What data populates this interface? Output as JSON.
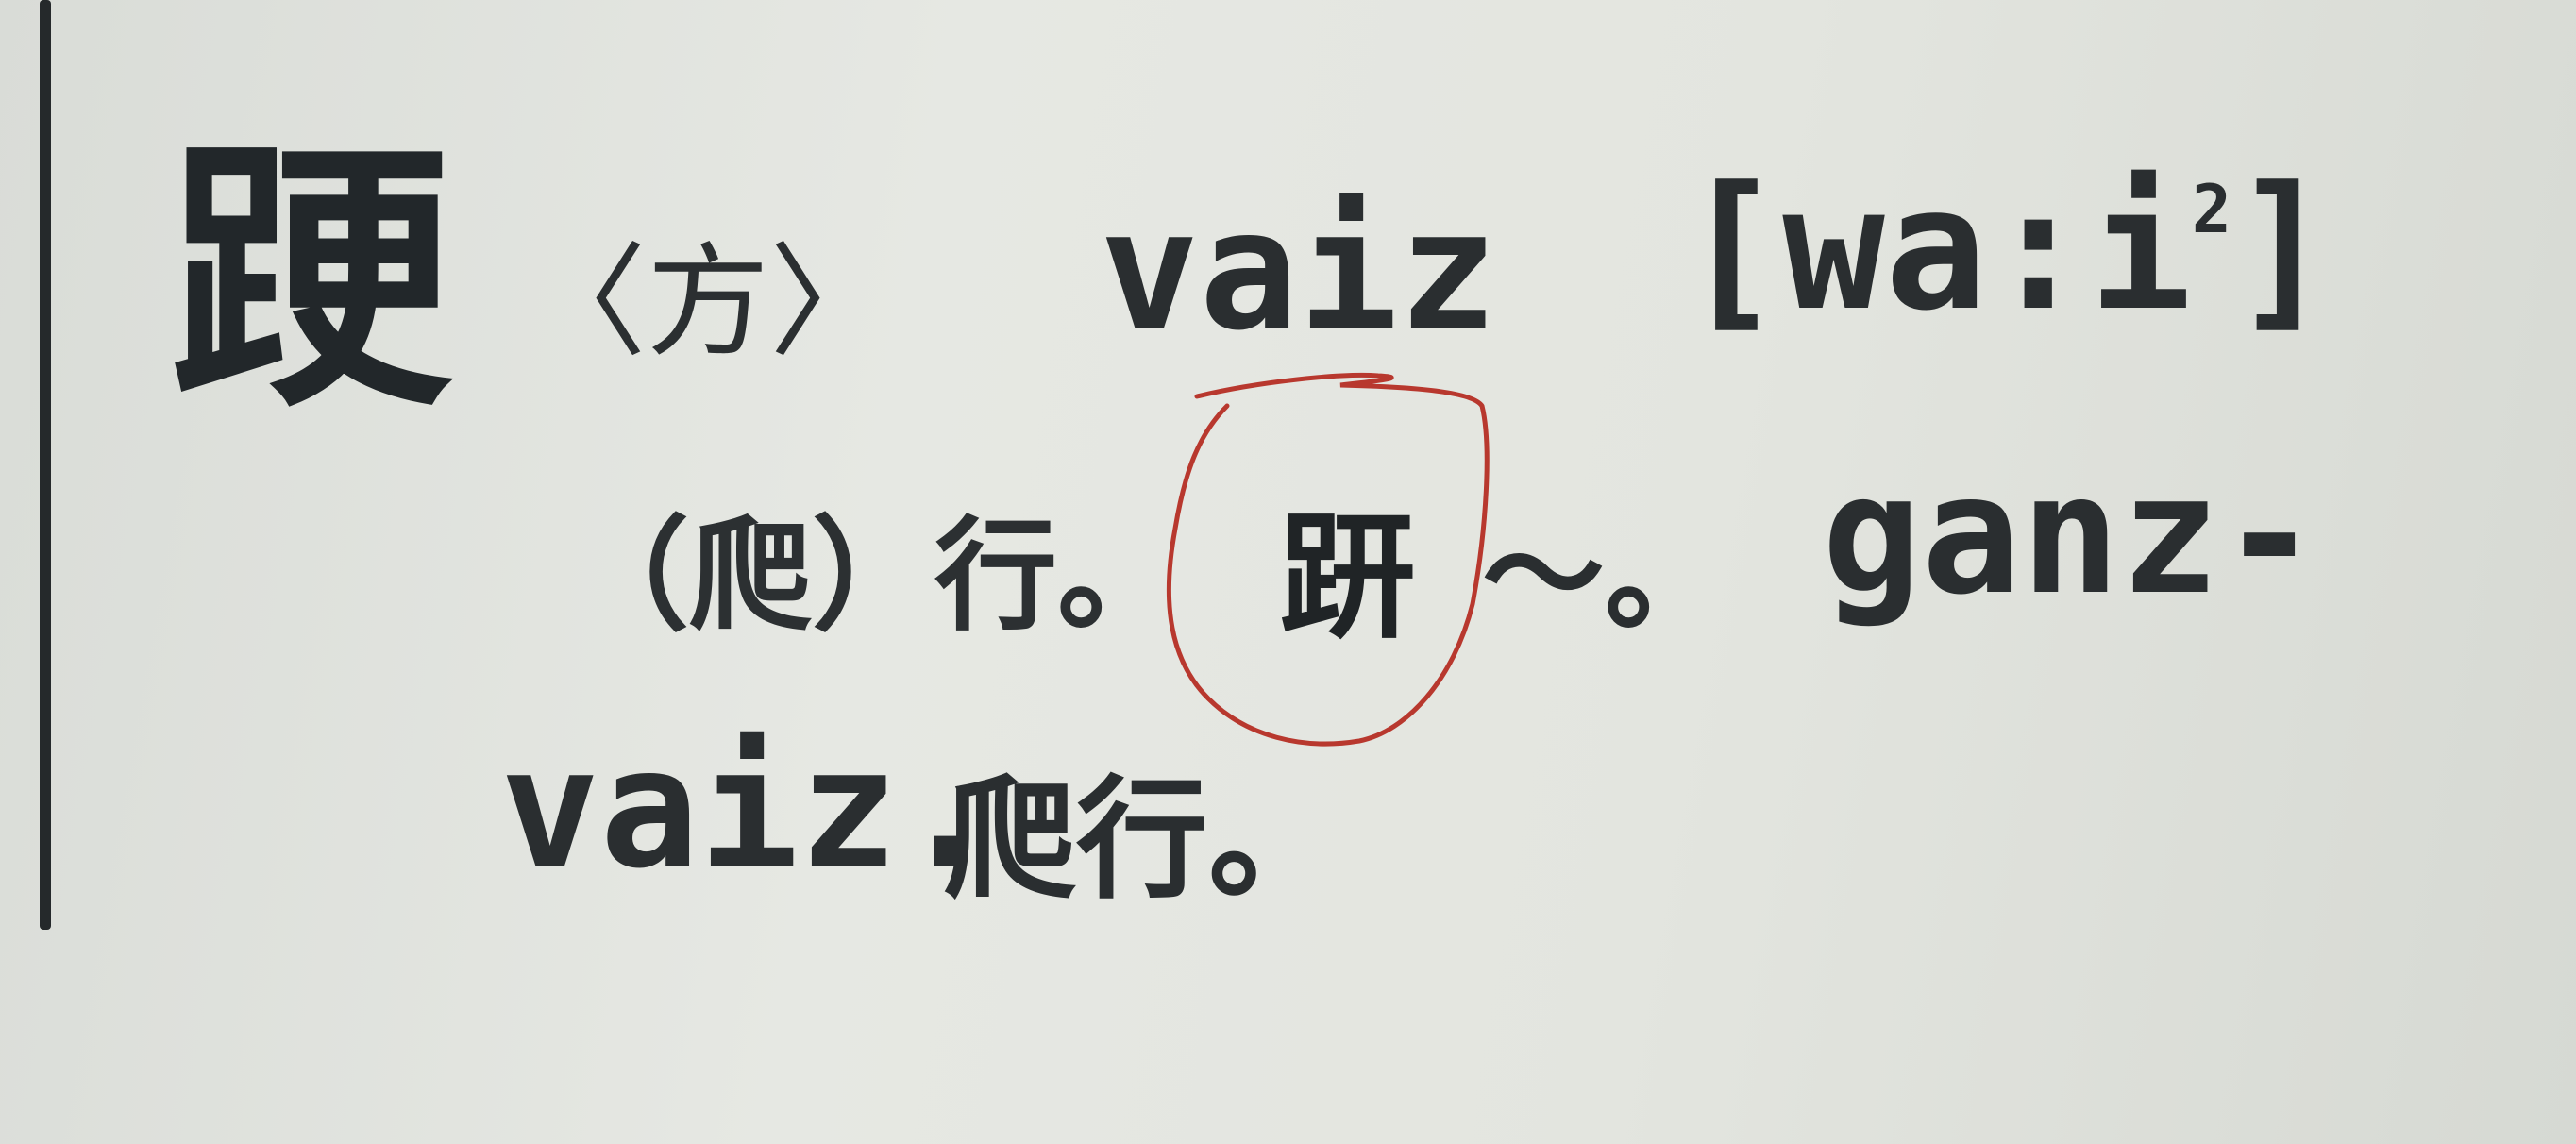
{
  "entry": {
    "headword": "𨁈",
    "dialect_tag": "〈方〉",
    "romanization": "vaiz",
    "ipa_base": "[wa:i",
    "ipa_tone": "2",
    "ipa_close": "]",
    "definition": "（爬）行。",
    "variant_char": "趼",
    "tilde": "～。",
    "example_latin_start": "ganz-",
    "example_latin_end": "vaiz.",
    "example_gloss": "爬行。"
  },
  "annotation": {
    "color": "#b8382e",
    "target": "variant_char"
  }
}
